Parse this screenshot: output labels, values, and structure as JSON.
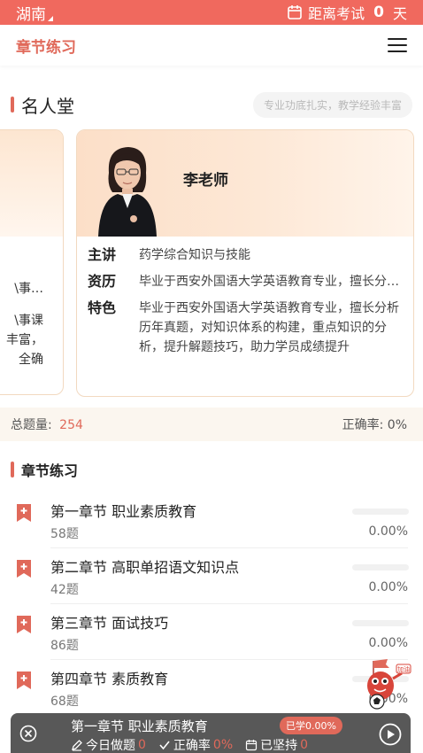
{
  "status_bar": {
    "region": "湖南",
    "exam_prefix": "距离考试",
    "exam_days": "0",
    "exam_unit": "天"
  },
  "header": {
    "title": "章节练习"
  },
  "hall_of_fame": {
    "title": "名人堂",
    "tagline": "专业功底扎实，教学经验丰富",
    "side_card_lines": [
      "\\事…",
      "\\事课",
      "丰富，",
      "全确"
    ],
    "teacher": {
      "name": "李老师",
      "main_label": "主讲",
      "main_value": "药学综合知识与技能",
      "resume_label": "资历",
      "resume_value": "毕业于西安外国语大学英语教育专业，擅长分析历年真题",
      "feature_label": "特色",
      "feature_value": "毕业于西安外国语大学英语教育专业，擅长分析历年真题，对知识体系的构建，重点知识的分析，提升解题技巧，助力学员成绩提升"
    }
  },
  "stats": {
    "total_label": "总题量:",
    "total_value": "254",
    "accuracy_label": "正确率:",
    "accuracy_value": "0%"
  },
  "chapter_section": {
    "title": "章节练习",
    "chapters": [
      {
        "name": "第一章节 职业素质教育",
        "questions": "58题",
        "percent": "0.00%",
        "progress": 0
      },
      {
        "name": "第二章节 高职单招语文知识点",
        "questions": "42题",
        "percent": "0.00%",
        "progress": 0
      },
      {
        "name": "第三章节 面试技巧",
        "questions": "86题",
        "percent": "0.00%",
        "progress": 0
      },
      {
        "name": "第四章节 素质教育",
        "questions": "68题",
        "percent": "0.00%",
        "progress": 0
      }
    ]
  },
  "mascot": {
    "flag_text": "加油"
  },
  "bottom_bar": {
    "current_chapter": "第一章节 职业素质教育",
    "learned_badge": "已学0.00%",
    "today_label": "今日做题",
    "today_value": "0",
    "accuracy_label": "正确率",
    "accuracy_value": "0%",
    "streak_label": "已坚持",
    "streak_value": "0"
  },
  "colors": {
    "accent": "#e0695a",
    "status_bar": "#f0695e",
    "bottom_bar": "#585858"
  }
}
